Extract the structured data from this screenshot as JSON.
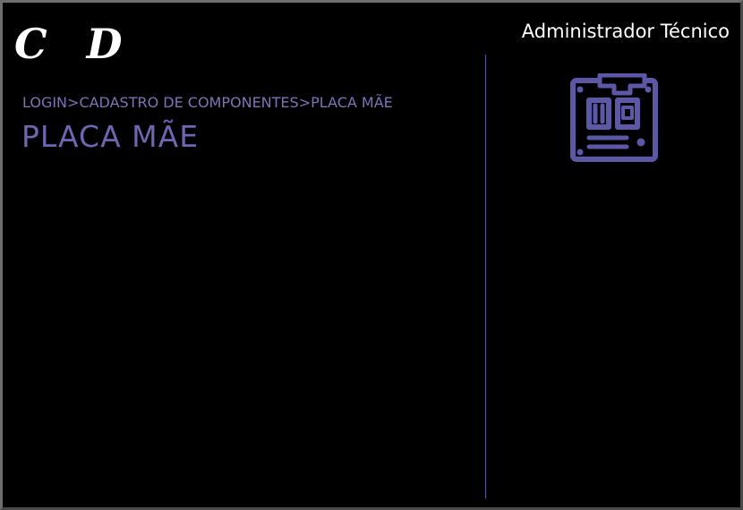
{
  "header": {
    "logo_text": "C D",
    "user_role": "Administrador Técnico"
  },
  "breadcrumb": {
    "items": [
      "LOGIN",
      "CADASTRO DE COMPONENTES",
      "PLACA MÃE"
    ],
    "separator": ">"
  },
  "page": {
    "title": "PLACA MÃE"
  },
  "sidebar": {
    "icon": "motherboard-icon"
  },
  "colors": {
    "background": "#000000",
    "accent": "#5d57a8",
    "text": "#ffffff"
  }
}
